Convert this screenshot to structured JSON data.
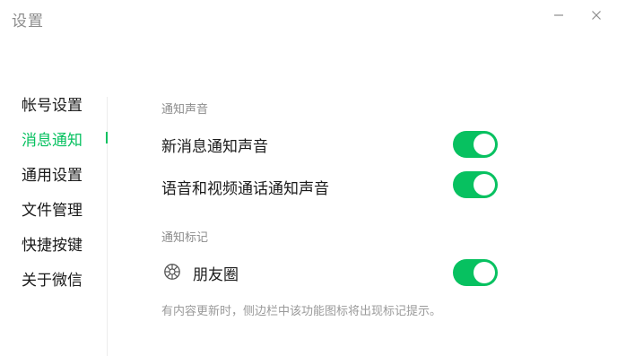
{
  "window": {
    "title": "设置"
  },
  "sidebar": {
    "items": [
      {
        "label": "帐号设置",
        "active": false
      },
      {
        "label": "消息通知",
        "active": true
      },
      {
        "label": "通用设置",
        "active": false
      },
      {
        "label": "文件管理",
        "active": false
      },
      {
        "label": "快捷按键",
        "active": false
      },
      {
        "label": "关于微信",
        "active": false
      }
    ]
  },
  "main": {
    "sound_section": {
      "title": "通知声音",
      "items": [
        {
          "label": "新消息通知声音",
          "enabled": true
        },
        {
          "label": "语音和视频通话通知声音",
          "enabled": true
        }
      ]
    },
    "badge_section": {
      "title": "通知标记",
      "items": [
        {
          "label": "朋友圈",
          "icon": "moments-icon",
          "enabled": true
        }
      ],
      "hint": "有内容更新时，侧边栏中该功能图标将出现标记提示。"
    }
  },
  "colors": {
    "accent": "#07c160",
    "muted_text": "#8c8c8c",
    "divider": "#ececec"
  }
}
